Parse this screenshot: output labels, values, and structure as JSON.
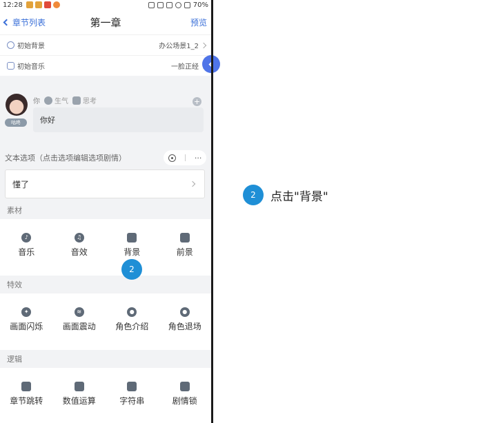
{
  "status_bar": {
    "time": "12:28",
    "battery": "70%"
  },
  "nav": {
    "back_label": "章节列表",
    "title": "第一章",
    "preview_label": "预览"
  },
  "settings": [
    {
      "label": "初始背景",
      "value": "办公场景1_2"
    },
    {
      "label": "初始音乐",
      "value": "一脸正经"
    }
  ],
  "dialogue": {
    "avatar_tag": "咕咚",
    "speaker": "你",
    "emote_1": "生气",
    "emote_2": "思考",
    "text": "你好"
  },
  "options": {
    "header": "文本选项（点击选项编辑选项剧情）",
    "more": "···",
    "items": [
      {
        "label": "懂了"
      }
    ]
  },
  "sections": [
    {
      "label": "素材",
      "tools": [
        "音乐",
        "音效",
        "背景",
        "前景"
      ]
    },
    {
      "label": "特效",
      "tools": [
        "画面闪烁",
        "画面震动",
        "角色介绍",
        "角色退场"
      ]
    },
    {
      "label": "逻辑",
      "tools": [
        "章节跳转",
        "数值运算",
        "字符串",
        "剧情锁"
      ]
    }
  ],
  "tutorial": {
    "step_number": "2",
    "instruction": "点击\"背景\""
  },
  "colors": {
    "accent": "#3a6fd8",
    "step_badge": "#1f8fd6"
  }
}
